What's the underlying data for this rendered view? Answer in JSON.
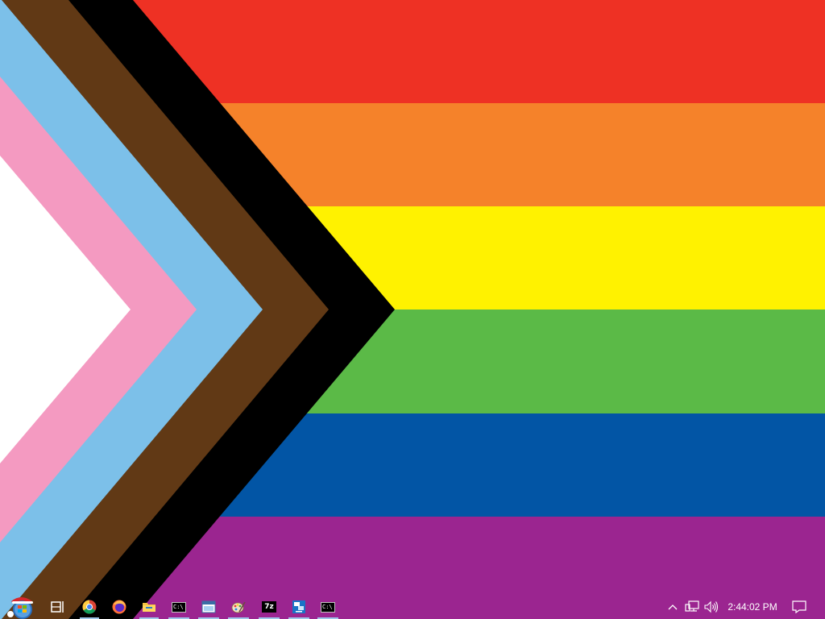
{
  "wallpaper": {
    "name": "progress-pride-flag",
    "colors": {
      "stripes": [
        "#ee3124",
        "#f5822a",
        "#fff200",
        "#5bba47",
        "#0255a5",
        "#9b2590"
      ],
      "chevrons": [
        "#000000",
        "#613915",
        "#7cc0e9",
        "#f49ac1",
        "#ffffff"
      ]
    }
  },
  "taskbar": {
    "start_icon": "windows-start-orb-santa-icon",
    "apps": [
      {
        "icon": "task-view-icon",
        "running": false
      },
      {
        "icon": "chrome-icon",
        "running": true
      },
      {
        "icon": "firefox-icon",
        "running": false
      },
      {
        "icon": "file-explorer-icon",
        "running": true
      },
      {
        "icon": "command-prompt-icon",
        "running": true
      },
      {
        "icon": "window-app-icon",
        "running": true
      },
      {
        "icon": "paint-icon",
        "running": true
      },
      {
        "icon": "7zip-icon",
        "running": true
      },
      {
        "icon": "remote-desktop-icon",
        "running": true
      },
      {
        "icon": "command-prompt-icon",
        "running": true
      }
    ],
    "cmd_label": "C:\\",
    "sevenzip_label": "7z",
    "tray": {
      "icons": [
        "chevron-up-icon",
        "network-icon",
        "volume-icon"
      ],
      "clock": "2:44:02 PM",
      "notification_icon": "action-center-icon"
    }
  }
}
